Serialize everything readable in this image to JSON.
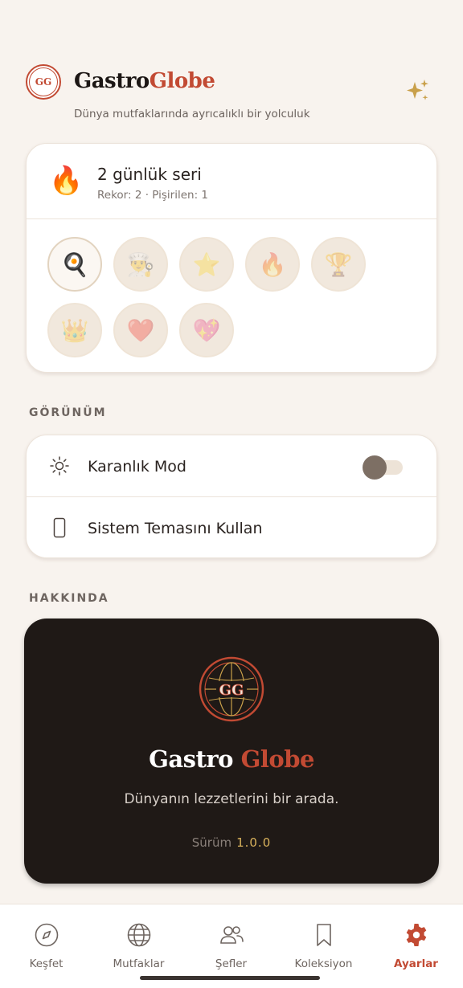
{
  "brand": {
    "part1": "Gastro",
    "part2": "Globe",
    "logo_text": "GG",
    "tagline": "Dünya mutfaklarında ayrıcalıklı bir yolculuk"
  },
  "streak": {
    "title": "2 günlük seri",
    "subtitle": "Rekor: 2 · Pişirilen: 1",
    "badges": [
      {
        "emoji": "🍳",
        "name": "cooking",
        "active": true
      },
      {
        "emoji": "👨‍🍳",
        "name": "chef",
        "active": false
      },
      {
        "emoji": "⭐",
        "name": "star",
        "active": false
      },
      {
        "emoji": "🔥",
        "name": "fire",
        "active": false
      },
      {
        "emoji": "🏆",
        "name": "trophy",
        "active": false
      },
      {
        "emoji": "👑",
        "name": "crown",
        "active": false
      },
      {
        "emoji": "❤️",
        "name": "heart",
        "active": false
      },
      {
        "emoji": "💖",
        "name": "sparkling-heart",
        "active": false
      }
    ]
  },
  "sections": {
    "appearance": "GÖRÜNÜM",
    "about": "HAKKINDA"
  },
  "settings": {
    "dark_mode_label": "Karanlık Mod",
    "dark_mode_on": false,
    "system_theme_label": "Sistem Temasını Kullan"
  },
  "about": {
    "logo_text": "GG",
    "title_part1": "Gastro",
    "title_part2": "Globe",
    "description": "Dünyanın lezzetlerini bir arada.",
    "version_label": "Sürüm",
    "version_value": "1.0.0"
  },
  "nav": {
    "items": [
      {
        "label": "Keşfet",
        "icon": "compass-icon"
      },
      {
        "label": "Mutfaklar",
        "icon": "globe-icon"
      },
      {
        "label": "Şefler",
        "icon": "users-icon"
      },
      {
        "label": "Koleksiyon",
        "icon": "bookmark-icon"
      },
      {
        "label": "Ayarlar",
        "icon": "gear-icon",
        "active": true
      }
    ]
  },
  "colors": {
    "accent": "#c24a33",
    "gold": "#d9b25c",
    "dark": "#1f1916",
    "background": "#f8f3ee"
  }
}
